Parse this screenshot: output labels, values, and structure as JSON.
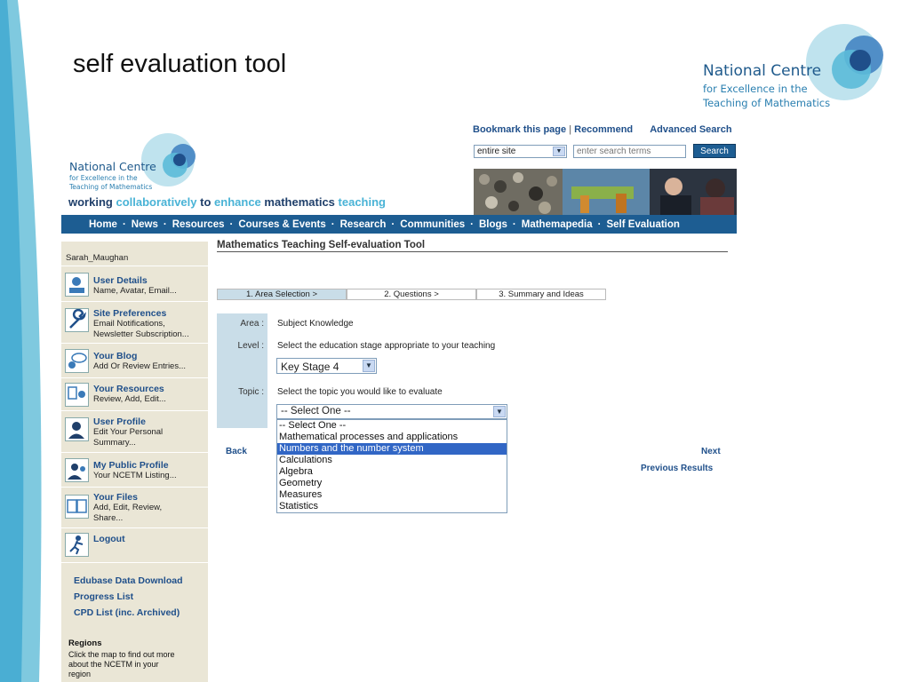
{
  "slide": {
    "title": "self evaluation tool"
  },
  "logo_large": {
    "line1": "National Centre",
    "line2": "for Excellence in the",
    "line3": "Teaching of Mathematics"
  },
  "logo_small": {
    "line1": "National Centre",
    "line2": "for Excellence in the",
    "line3": "Teaching of Mathematics"
  },
  "tagline": {
    "w1": "working",
    "w2": "collaboratively",
    "w3": "to",
    "w4": "enhance",
    "w5": "mathematics",
    "w6": "teaching"
  },
  "toplinks": {
    "bookmark": "Bookmark this page",
    "sep": "|",
    "recommend": "Recommend",
    "advanced": "Advanced Search"
  },
  "search": {
    "scope": "entire site",
    "placeholder": "enter search terms",
    "button": "Search"
  },
  "nav": [
    "Home",
    "News",
    "Resources",
    "Courses & Events",
    "Research",
    "Communities",
    "Blogs",
    "Mathemapedia",
    "Self Evaluation"
  ],
  "nav_sep": "·",
  "sidebar": {
    "user": "Sarah_Maughan",
    "items": [
      {
        "title": "User Details",
        "desc": "Name, Avatar, Email..."
      },
      {
        "title": "Site Preferences",
        "desc": "Email Notifications, Newsletter Subscription..."
      },
      {
        "title": "Your Blog",
        "desc": "Add Or Review Entries..."
      },
      {
        "title": "Your Resources",
        "desc": "Review, Add, Edit..."
      },
      {
        "title": "User Profile",
        "desc": "Edit Your Personal Summary..."
      },
      {
        "title": "My Public Profile",
        "desc": "Your NCETM Listing..."
      },
      {
        "title": "Your Files",
        "desc": "Add, Edit, Review, Share..."
      },
      {
        "title": "Logout",
        "desc": ""
      }
    ],
    "links": [
      "Edubase Data Download",
      "Progress List",
      "CPD List (inc. Archived)"
    ],
    "regions": {
      "title": "Regions",
      "text": "Click the map to find out more about the NCETM in your region"
    }
  },
  "main": {
    "heading": "Mathematics Teaching Self-evaluation Tool",
    "steps": [
      "1. Area Selection  >",
      "2. Questions  >",
      "3. Summary and Ideas"
    ],
    "area_label": "Area :",
    "area_value": "Subject Knowledge",
    "level_label": "Level :",
    "level_hint": "Select the education stage appropriate to your teaching",
    "level_value": "Key Stage 4",
    "topic_label": "Topic :",
    "topic_hint": "Select the topic you would like to evaluate",
    "topic_value": "-- Select One --",
    "topic_options": [
      "-- Select One --",
      "Mathematical processes and applications",
      "Numbers and the number system",
      "Calculations",
      "Algebra",
      "Geometry",
      "Measures",
      "Statistics"
    ],
    "topic_highlighted_index": 2,
    "back": "Back",
    "next": "Next",
    "previous": "Previous Results"
  },
  "colors": {
    "nav_bg": "#1d5d92",
    "sidebar_bg": "#eae6d6",
    "link": "#1f4f8a",
    "highlight": "#3166c5",
    "accent_light": "#49b3d6"
  }
}
